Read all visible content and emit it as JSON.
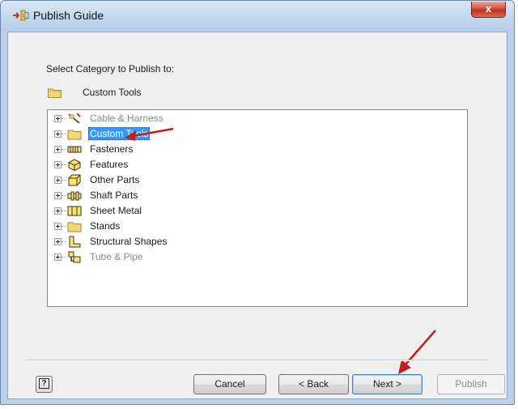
{
  "window": {
    "title": "Publish Guide",
    "app_icon": "publish-arrow-icon",
    "close_label": "x"
  },
  "prompt": {
    "select_label": "Select Category to Publish to:",
    "current_category": "Custom Tools",
    "current_icon": "folder-icon"
  },
  "tree": {
    "items": [
      {
        "label": "Cable & Harness",
        "icon": "cable-harness-icon",
        "disabled": true,
        "selected": false
      },
      {
        "label": "Custom Tools",
        "icon": "folder-icon",
        "disabled": false,
        "selected": true
      },
      {
        "label": "Fasteners",
        "icon": "fasteners-icon",
        "disabled": false,
        "selected": false
      },
      {
        "label": "Features",
        "icon": "features-icon",
        "disabled": false,
        "selected": false
      },
      {
        "label": "Other Parts",
        "icon": "other-parts-icon",
        "disabled": false,
        "selected": false
      },
      {
        "label": "Shaft Parts",
        "icon": "shaft-parts-icon",
        "disabled": false,
        "selected": false
      },
      {
        "label": "Sheet Metal",
        "icon": "sheet-metal-icon",
        "disabled": false,
        "selected": false
      },
      {
        "label": "Stands",
        "icon": "folder-icon",
        "disabled": false,
        "selected": false
      },
      {
        "label": "Structural Shapes",
        "icon": "structural-shapes-icon",
        "disabled": false,
        "selected": false
      },
      {
        "label": "Tube & Pipe",
        "icon": "tube-pipe-icon",
        "disabled": true,
        "selected": false
      }
    ]
  },
  "buttons": {
    "help_label": "?",
    "cancel": "Cancel",
    "back": "< Back",
    "next": "Next >",
    "publish": "Publish"
  },
  "colors": {
    "selection": "#3399ff",
    "annotation_arrow": "#c0201b",
    "icon_yellow": "#ffe26a"
  }
}
